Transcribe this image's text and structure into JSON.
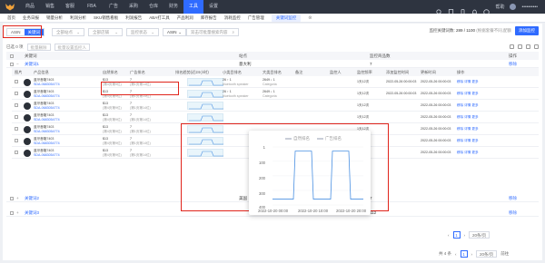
{
  "topnav": {
    "items": [
      "商品",
      "销售",
      "客服",
      "FBA",
      "广告",
      "采购",
      "仓库",
      "财务",
      "工具",
      "设置"
    ],
    "active_index": 8,
    "right": {
      "help_label": "帮助",
      "username": "••••••••••"
    }
  },
  "subnav": {
    "items": [
      "首页",
      "业务日报",
      "销量分析",
      "利润分析",
      "SKU销售看板",
      "利润报告",
      "ABA打工具",
      "产品利润",
      "库存报告",
      "消耗监控",
      "广告管理",
      "关键词监控"
    ],
    "active_index": 11
  },
  "filters": {
    "segment": [
      "ASIN",
      "关键词"
    ],
    "segment_active": 1,
    "site_placeholder": "全部站点",
    "store_placeholder": "全部店铺",
    "status_placeholder": "监控状态",
    "asin_select": "ASIN",
    "search_placeholder": "双击可批量搜索内容"
  },
  "quota": {
    "label": "监控关键词数:",
    "value": "289 / 1100",
    "note": "(根据套餐不同,配额"
  },
  "add_button": "添加监控",
  "toolbar": {
    "count": "已选 0 项",
    "batch_delete": "批量删除",
    "batch_monitor": "批量设置监控人"
  },
  "group_header": {
    "col1": "关键词",
    "col2": "站点",
    "col3": "监控商品数",
    "col4": "操作"
  },
  "group_row": {
    "keyword": "关键词1",
    "site": "意大利",
    "count": "7",
    "action": "移除"
  },
  "table": {
    "headers": [
      "图片",
      "产品信息",
      "自然排名",
      "广告排名",
      "排名趋势(近24小时)",
      "小类目排名",
      "大类目排名",
      "备注",
      "监控人",
      "监控频率",
      "添加监控时间",
      "更新时间",
      "操作"
    ],
    "rows": [
      {
        "name": "蓝牙音箱7403",
        "code": "SDA-0683054774",
        "nat": "$13",
        "nat_sub": "(第4页第9位)",
        "ad": "7",
        "ad_sub": "(第1页第14位)",
        "small": "26 ↑ 1",
        "small_sub": "bluetooth speaker",
        "big": "2649 ↓ 1",
        "big_sub": "Categoria",
        "freq": "1天12次",
        "added": "2022-05-26 00:00:03",
        "updated": "2022-05-26 00:00:03",
        "act": "移除  详情  更多"
      },
      {
        "name": "蓝牙音箱7403",
        "code": "SDA-0683054774",
        "nat": "$13",
        "nat_sub": "(第4页第9位)",
        "ad": "7",
        "ad_sub": "(第1页第14位)",
        "small": "26 ↑ 1",
        "small_sub": "bluetooth speaker",
        "big": "2649 ↓ 1",
        "big_sub": "Categoria",
        "freq": "1天12次",
        "added": "2022-05-26 00:00:03",
        "updated": "2022-05-26 00:00:03",
        "act": "移除  详情  更多"
      },
      {
        "name": "蓝牙音箱7403",
        "code": "SDA-0683054774",
        "nat": "$13",
        "nat_sub": "(第4页第9位)",
        "ad": "7",
        "ad_sub": "(第1页第14位)",
        "small": "",
        "small_sub": "",
        "big": "",
        "big_sub": "",
        "freq": "1天12次",
        "added": "",
        "updated": "2022-05-26 00:00:03",
        "act": "移除  详情  更多"
      },
      {
        "name": "蓝牙音箱7403",
        "code": "SDA-0683054774",
        "nat": "$13",
        "nat_sub": "(第4页第9位)",
        "ad": "7",
        "ad_sub": "(第1页第14位)",
        "small": "",
        "small_sub": "",
        "big": "",
        "big_sub": "",
        "freq": "1天12次",
        "added": "",
        "updated": "2022-05-26 00:00:03",
        "act": "移除  详情  更多"
      },
      {
        "name": "蓝牙音箱7403",
        "code": "SDA-0683054774",
        "nat": "$13",
        "nat_sub": "(第4页第9位)",
        "ad": "7",
        "ad_sub": "(第1页第14位)",
        "small": "",
        "small_sub": "",
        "big": "",
        "big_sub": "",
        "freq": "1天12次",
        "added": "",
        "updated": "2022-05-26 00:00:03",
        "act": "移除  详情  更多"
      },
      {
        "name": "蓝牙音箱7403",
        "code": "SDA-0683054774",
        "nat": "$13",
        "nat_sub": "(第4页第9位)",
        "ad": "7",
        "ad_sub": "(第1页第14位)",
        "small": "",
        "small_sub": "",
        "big": "",
        "big_sub": "",
        "freq": "1天12次",
        "added": "",
        "updated": "2022-05-26 00:00:03",
        "act": "移除  详情  更多"
      },
      {
        "name": "蓝牙音箱7403",
        "code": "SDA-0683054774",
        "nat": "$13",
        "nat_sub": "(第4页第9位)",
        "ad": "7",
        "ad_sub": "(第1页第14位)",
        "small": "",
        "small_sub": "",
        "big": "",
        "big_sub": "",
        "freq": "1天12次",
        "added": "",
        "updated": "2022-05-26 00:00:03",
        "act": "移除  详情  更多"
      }
    ]
  },
  "pager_inner": {
    "page": "1",
    "size": "20条/页"
  },
  "group_rows_bottom": [
    {
      "keyword": "关键词2",
      "site": "美国",
      "count": "7",
      "action": "移除"
    },
    {
      "keyword": "关键词3",
      "site": "",
      "count": "112",
      "action": "移除"
    }
  ],
  "pager_outer": {
    "total": "共 4 条",
    "page": "1",
    "size": "20条/页",
    "goto": "前往"
  },
  "popup_chart": {
    "legend": [
      "自然排名",
      "广告排名"
    ],
    "ytick_labels": [
      "1",
      "100",
      "200",
      "300",
      "400"
    ]
  },
  "chart_data": {
    "type": "line",
    "x": [
      "2022-10-20 00:00",
      "2022-10-20 10:00",
      "2022-10-20 20:00"
    ],
    "ylim": [
      1,
      400
    ],
    "yreversed": true,
    "series": [
      {
        "name": "自然排名",
        "segments": [
          [
            0,
            360
          ],
          [
            2.3,
            360
          ],
          [
            2.5,
            30
          ],
          [
            4.3,
            30
          ],
          [
            4.5,
            360
          ],
          [
            6.4,
            360
          ],
          [
            6.6,
            30
          ],
          [
            8.4,
            30
          ],
          [
            8.6,
            360
          ],
          [
            10,
            360
          ]
        ]
      }
    ]
  },
  "colors": {
    "accent": "#2f6bff",
    "red_box": "#e0241b",
    "line": "#4a90e2"
  }
}
